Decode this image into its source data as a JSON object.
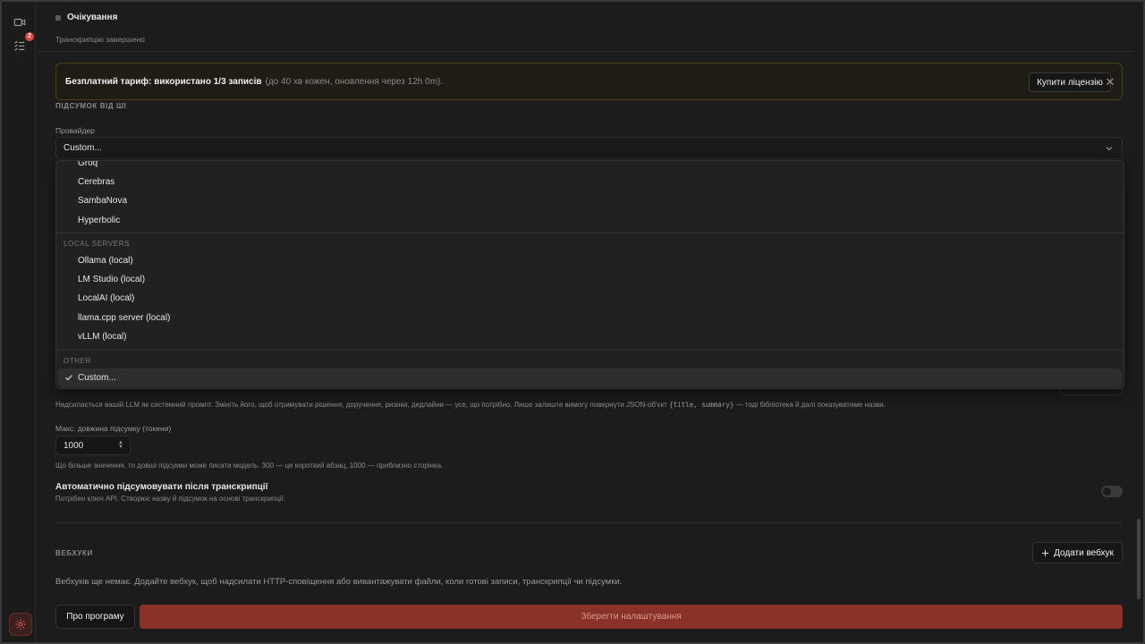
{
  "sidebar": {
    "badge_count": "2"
  },
  "status": {
    "title": "Очікування",
    "subtitle": "Транскрипцію завершено"
  },
  "banner": {
    "strong": "Безплатний тариф: використано 1/3 записів",
    "soft": "(до 40 хв кожен, оновлення через 12h 0m).",
    "buy_label": "Купити ліцензію",
    "close_glyph": "✕"
  },
  "summary": {
    "section_label": "ПІДСУМОК ВІД ШІ",
    "provider_label": "Провайдер",
    "provider_value": "Custom...",
    "dropdown": {
      "partial_item": "Groq",
      "cloud_items": [
        "Cerebras",
        "SambaNova",
        "Hyperbolic"
      ],
      "local_group": "LOCAL SERVERS",
      "local_items": [
        "Ollama (local)",
        "LM Studio (local)",
        "LocalAI (local)",
        "llama.cpp server (local)",
        "vLLM (local)"
      ],
      "other_group": "OTHER",
      "other_items": [
        "Custom..."
      ],
      "selected": "Custom..."
    },
    "prompt_help_before": "Надсилається вашій LLM як системний промпт. Змініть його, щоб отримувати рішення, доручення, ризики, дедлайни — усе, що потрібно. Лише залиште вимогу повернути JSON-об'єкт",
    "prompt_help_code": "{title, summary}",
    "prompt_help_after": "— тоді бібліотека й далі показуватиме назви.",
    "max_len_label": "Макс. довжина підсумку (токени)",
    "max_len_value": "1000",
    "max_len_help": "Що більше значення, то довші підсумки може писати модель. 300 — це короткий абзац, 1000 — приблизно сторінка.",
    "auto_title": "Автоматично підсумовувати після транскрипції",
    "auto_help": "Потрібен ключ API. Створює назву й підсумок на основі транскрипції.",
    "auto_enabled": false
  },
  "webhooks": {
    "section_label": "ВЕБХУКИ",
    "add_label": "Додати вебхук",
    "empty_text": "Вебхуків ще немає. Додайте вебхук, щоб надсилати HTTP-сповіщення або вивантажувати файли, коли готові записи, транскрипції чи підсумки."
  },
  "footer": {
    "about_label": "Про програму",
    "save_label": "Зберегти налаштування"
  },
  "colors": {
    "accent": "#8a3128",
    "background": "#1c1c1c",
    "banner_border": "#4a3d1a"
  }
}
